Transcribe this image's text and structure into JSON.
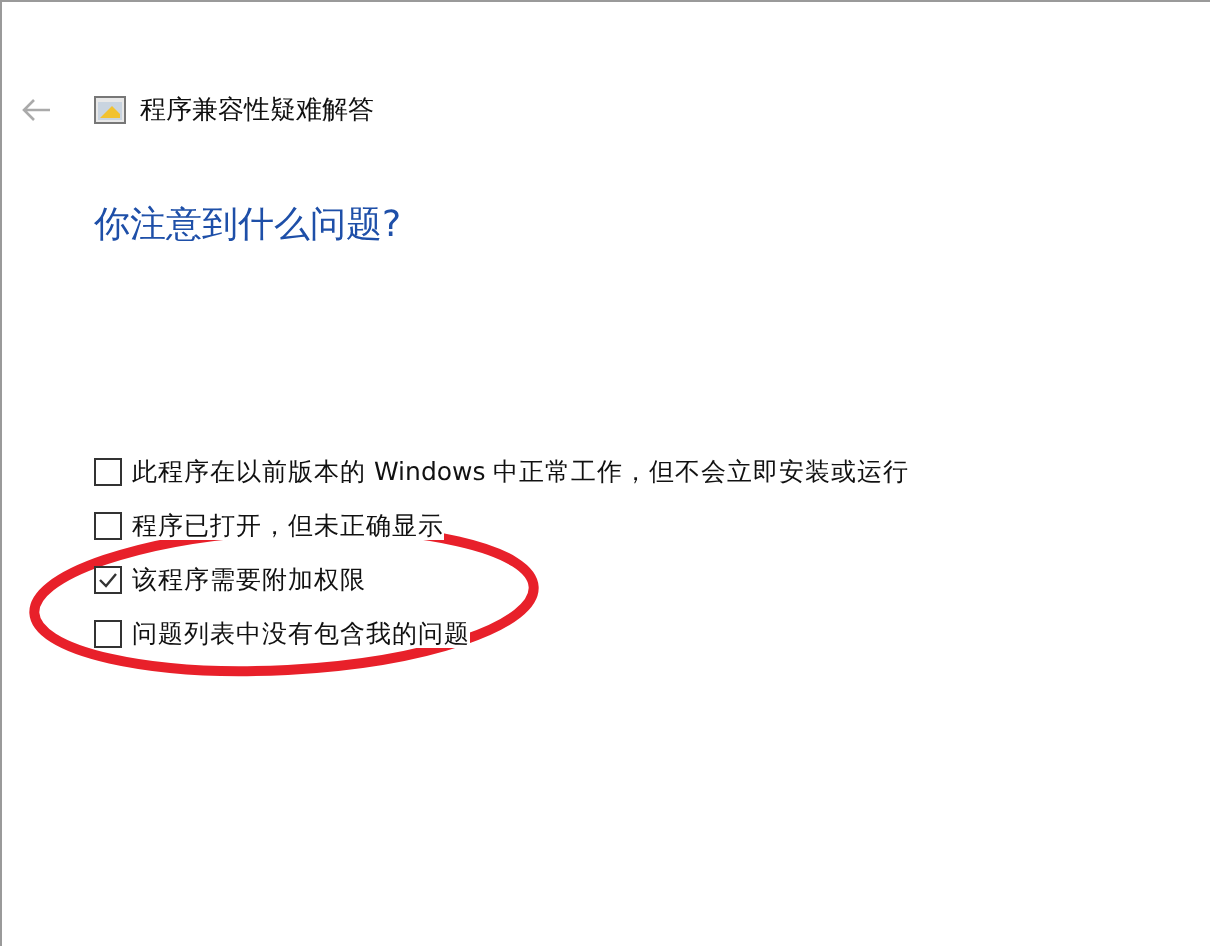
{
  "window": {
    "title": "程序兼容性疑难解答"
  },
  "heading": "你注意到什么问题?",
  "options": [
    {
      "label": "此程序在以前版本的 Windows 中正常工作，但不会立即安装或运行",
      "checked": false
    },
    {
      "label": "程序已打开，但未正确显示",
      "checked": false
    },
    {
      "label": "该程序需要附加权限",
      "checked": true
    },
    {
      "label": "问题列表中没有包含我的问题",
      "checked": false
    }
  ],
  "annotation": {
    "kind": "ellipse",
    "color": "#e8202a"
  }
}
